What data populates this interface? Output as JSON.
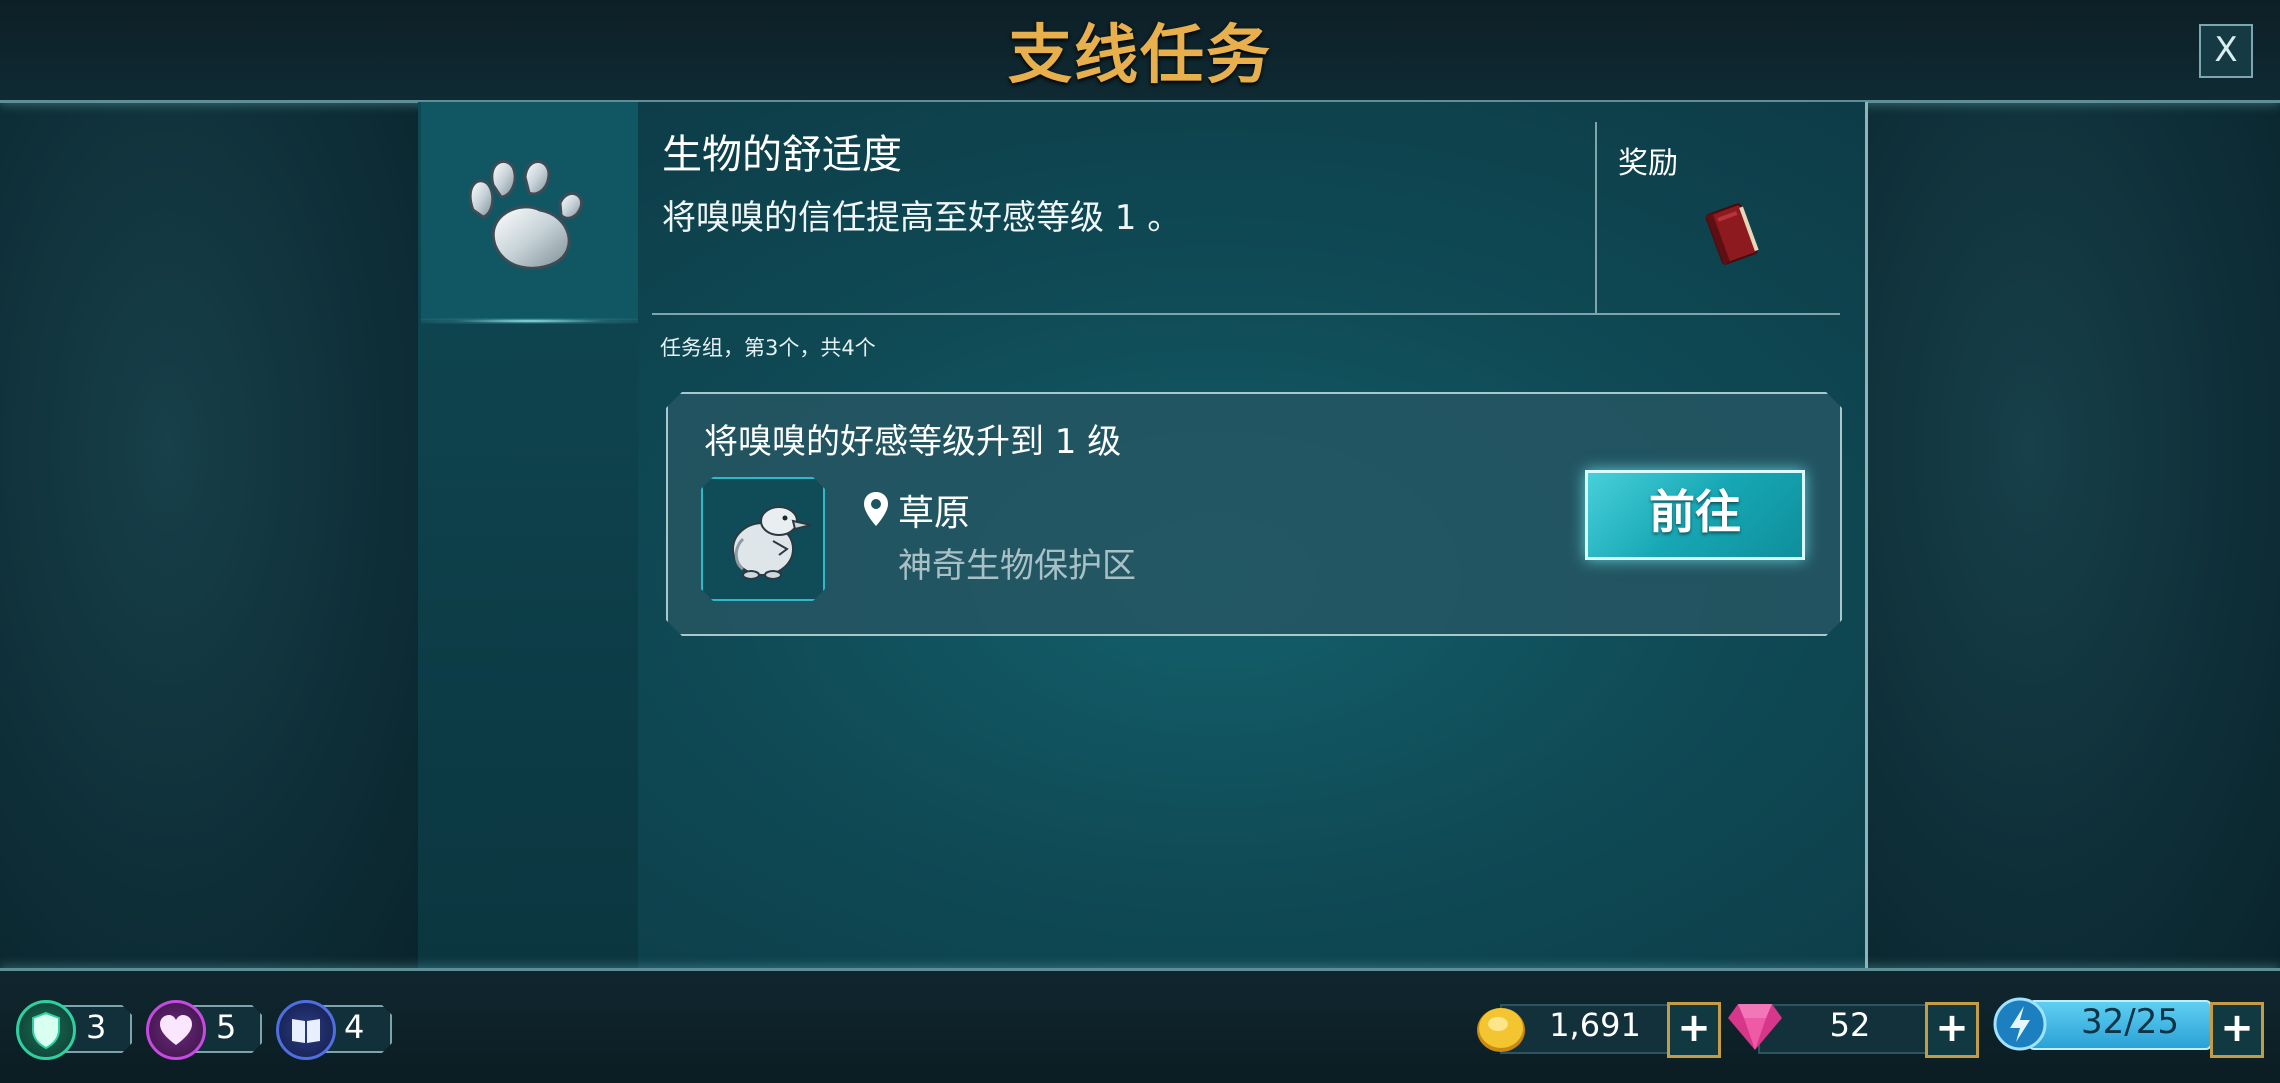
{
  "header": {
    "title": "支线任务",
    "close_label": "X"
  },
  "quest": {
    "title": "生物的舒适度",
    "description": "将嗅嗅的信任提高至好感等级 1 。",
    "reward_label": "奖励",
    "reward_item": "red-book-icon",
    "group_info": "任务组，第3个，共4个"
  },
  "task": {
    "title": "将嗅嗅的好感等级升到 1 级",
    "creature_icon": "niffler-icon",
    "location_name": "草原",
    "location_sub": "神奇生物保护区",
    "go_label": "前往"
  },
  "footer": {
    "stats": [
      {
        "icon": "shield-icon",
        "value": "3",
        "color": "#2fd0a0"
      },
      {
        "icon": "heart-icon",
        "value": "5",
        "color": "#c54be0"
      },
      {
        "icon": "book-icon",
        "value": "4",
        "color": "#4f6fe0"
      }
    ],
    "gold": "1,691",
    "gems": "52",
    "energy": "32/25",
    "plus": "+"
  },
  "colors": {
    "title_gold": "#e7b04d",
    "panel_teal": "#13606b",
    "button_cyan": "#1aa8b5"
  }
}
